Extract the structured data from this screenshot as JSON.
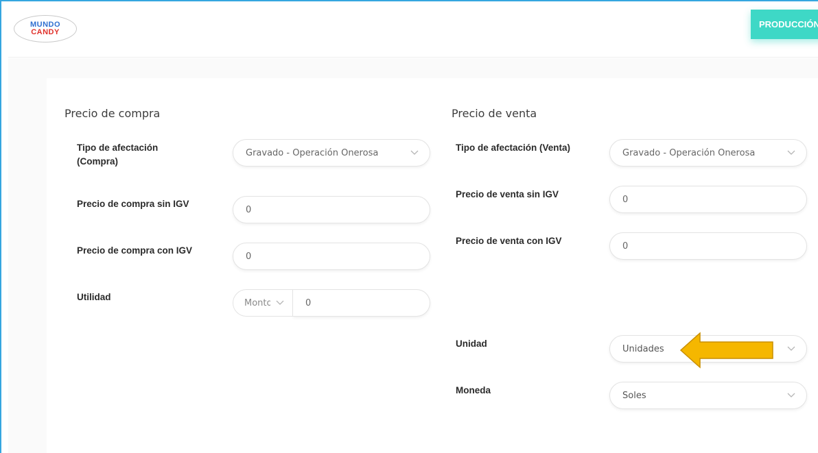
{
  "header": {
    "logo": {
      "line1": "MUNDO",
      "line2": "CANDY"
    },
    "production_button": "PRODUCCIÓN"
  },
  "compra": {
    "title": "Precio de compra",
    "tipo_afectacion": {
      "label": "Tipo de afectación (Compra)",
      "value": "Gravado - Operación Onerosa"
    },
    "precio_sin_igv": {
      "label": "Precio de compra sin IGV",
      "value": "0"
    },
    "precio_con_igv": {
      "label": "Precio de compra con IGV",
      "value": "0"
    },
    "utilidad": {
      "label": "Utilidad",
      "type_value": "Monto",
      "value": "0"
    }
  },
  "venta": {
    "title": "Precio de venta",
    "tipo_afectacion": {
      "label": "Tipo de afectación (Venta)",
      "value": "Gravado - Operación Onerosa"
    },
    "precio_sin_igv": {
      "label": "Precio de venta sin IGV",
      "value": "0"
    },
    "precio_con_igv": {
      "label": "Precio de venta con IGV",
      "value": "0"
    },
    "unidad": {
      "label": "Unidad",
      "value": "Unidades"
    },
    "moneda": {
      "label": "Moneda",
      "value": "Soles"
    }
  },
  "annotation": {
    "arrow_icon": "left-arrow-icon",
    "arrow_color": "#f5b700"
  },
  "colors": {
    "accent": "#3ed8c6",
    "frame": "#35a6e0"
  }
}
